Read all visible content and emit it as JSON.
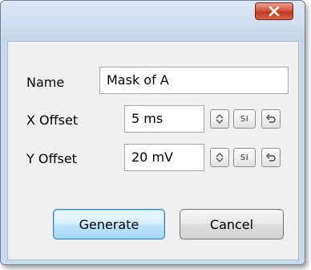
{
  "dialog": {
    "close_icon": "close-icon",
    "name_label": "Name",
    "name_value": "Mask of A",
    "x_offset_label": "X Offset",
    "x_offset_value": "5 ms",
    "y_offset_label": "Y Offset",
    "y_offset_value": "20 mV",
    "si_label": "SI",
    "generate_label": "Generate",
    "cancel_label": "Cancel"
  },
  "colors": {
    "title_bar": "#c9daee",
    "close_button": "#c13a1f",
    "default_button": "#bee6fd",
    "client_background": "#f0f0f0"
  }
}
